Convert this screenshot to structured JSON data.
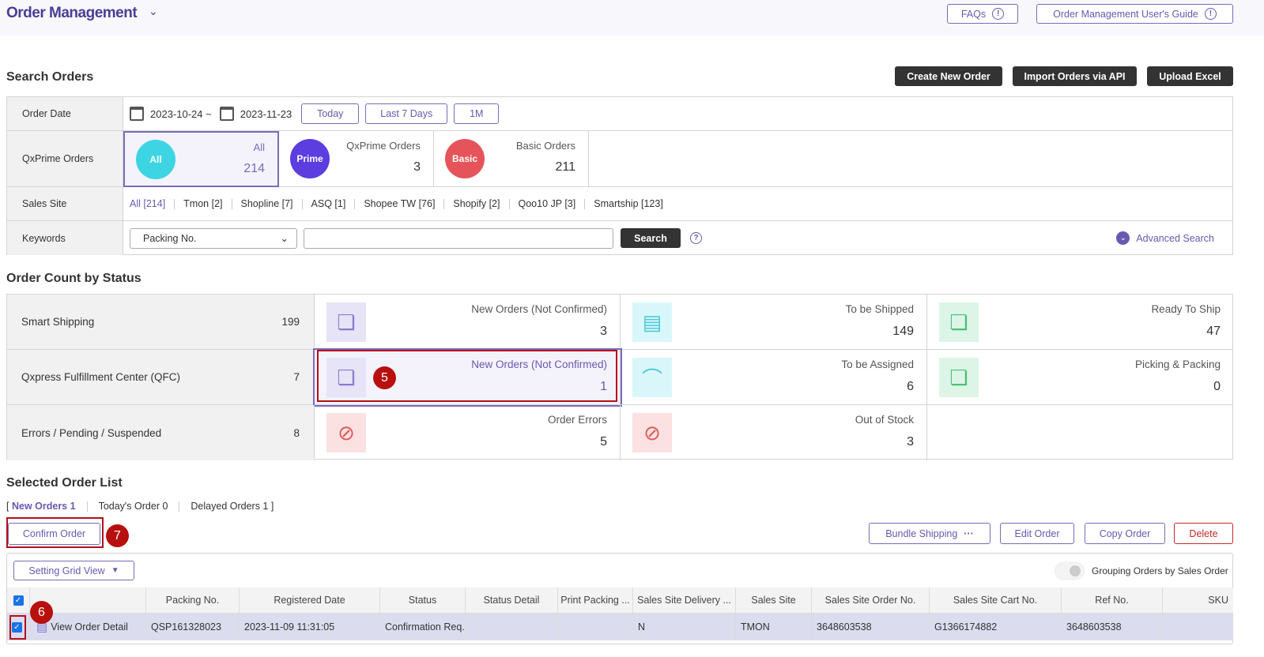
{
  "header": {
    "title": "Order Management",
    "faqs": "FAQs",
    "guide": "Order Management User's Guide"
  },
  "search": {
    "title": "Search Orders",
    "create": "Create New Order",
    "import": "Import Orders via API",
    "upload": "Upload Excel",
    "labels": {
      "order_date": "Order Date",
      "qxprime": "QxPrime Orders",
      "sales_site": "Sales Site",
      "keywords": "Keywords"
    },
    "date_from": "2023-10-24",
    "tilde": "~",
    "date_to": "2023-11-23",
    "today": "Today",
    "last7": "Last 7 Days",
    "m1": "1M",
    "qx": [
      {
        "badge": "All",
        "label": "All",
        "count": "214",
        "color": "#3dd5e3"
      },
      {
        "badge": "Prime",
        "label": "QxPrime Orders",
        "count": "3",
        "color": "#5b3de0"
      },
      {
        "badge": "Basic",
        "label": "Basic Orders",
        "count": "211",
        "color": "#e5545a"
      }
    ],
    "sites": [
      "All [214]",
      "Tmon [2]",
      "Shopline [7]",
      "ASQ [1]",
      "Shopee TW [76]",
      "Shopify [2]",
      "Qoo10 JP [3]",
      "Smartship [123]"
    ],
    "keyword_type": "Packing No.",
    "keyword_value": "",
    "search_btn": "Search",
    "advanced": "Advanced Search"
  },
  "status": {
    "title": "Order Count by Status",
    "rows": [
      {
        "label": "Smart Shipping",
        "count": "199",
        "cells": [
          {
            "t": "New Orders (Not Confirmed)",
            "n": "3"
          },
          {
            "t": "To be Shipped",
            "n": "149"
          },
          {
            "t": "Ready To Ship",
            "n": "47"
          }
        ]
      },
      {
        "label": "Qxpress Fulfillment Center (QFC)",
        "count": "7",
        "cells": [
          {
            "t": "New Orders (Not Confirmed)",
            "n": "1"
          },
          {
            "t": "To be Assigned",
            "n": "6"
          },
          {
            "t": "Picking & Packing",
            "n": "0"
          }
        ]
      },
      {
        "label": "Errors / Pending / Suspended",
        "count": "8",
        "cells": [
          {
            "t": "Order Errors",
            "n": "5"
          },
          {
            "t": "Out of Stock",
            "n": "3"
          }
        ]
      }
    ]
  },
  "list": {
    "title": "Selected Order List",
    "tabs": [
      "New Orders 1",
      "Today's Order 0",
      "Delayed Orders 1"
    ],
    "confirm": "Confirm Order",
    "bundle": "Bundle Shipping",
    "edit": "Edit Order",
    "copy": "Copy Order",
    "delete": "Delete",
    "grid_view": "Setting Grid View",
    "grouping": "Grouping Orders by Sales Order",
    "columns": [
      "",
      "Packing No.",
      "Registered Date",
      "Status",
      "Status Detail",
      "Print Packing ...",
      "Sales Site Delivery ...",
      "Sales Site",
      "Sales Site Order No.",
      "Sales Site Cart No.",
      "Ref No.",
      "SKU"
    ],
    "row": [
      "View Order Detail",
      "QSP161328023",
      "2023-11-09 11:31:05",
      "Confirmation Req...",
      "",
      "",
      "N",
      "TMON",
      "3648603538",
      "G1366174882",
      "3648603538",
      ""
    ]
  },
  "annotations": {
    "a5": "5",
    "a6": "6",
    "a7": "7"
  }
}
